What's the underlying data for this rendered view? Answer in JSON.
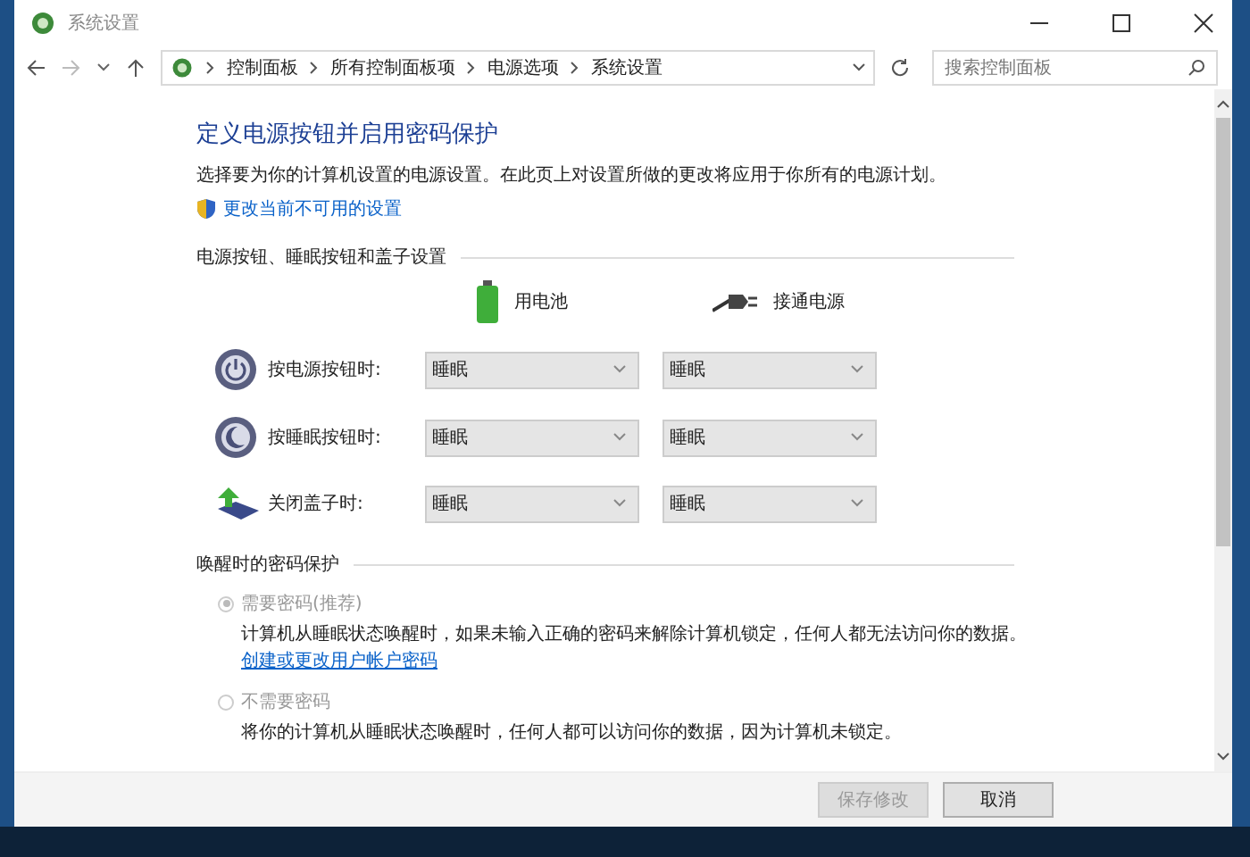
{
  "window": {
    "title": "系统设置"
  },
  "address_bar": {
    "breadcrumbs": [
      "控制面板",
      "所有控制面板项",
      "电源选项",
      "系统设置"
    ],
    "search": {
      "placeholder": "搜索控制面板"
    }
  },
  "page": {
    "heading": "定义电源按钮并启用密码保护",
    "description": "选择要为你的计算机设置的电源设置。在此页上对设置所做的更改将应用于你所有的电源计划。",
    "admin_link": "更改当前不可用的设置",
    "power_section": {
      "title": "电源按钮、睡眠按钮和盖子设置",
      "columns": [
        "用电池",
        "接通电源"
      ],
      "rows": [
        {
          "kind": "power",
          "label": "按电源按钮时:",
          "battery": "睡眠",
          "plugged": "睡眠"
        },
        {
          "kind": "sleep",
          "label": "按睡眠按钮时:",
          "battery": "睡眠",
          "plugged": "睡眠"
        },
        {
          "kind": "lid",
          "label": "关闭盖子时:",
          "battery": "睡眠",
          "plugged": "睡眠"
        }
      ]
    },
    "password_section": {
      "title": "唤醒时的密码保护",
      "options": [
        {
          "label": "需要密码(推荐)",
          "selected": true,
          "disabled": true,
          "description": "计算机从睡眠状态唤醒时，如果未输入正确的密码来解除计算机锁定，任何人都无法访问你的数据。",
          "link": "创建或更改用户帐户密码"
        },
        {
          "label": "不需要密码",
          "selected": false,
          "disabled": true,
          "description": "将你的计算机从睡眠状态唤醒时，任何人都可以访问你的数据，因为计算机未锁定。"
        }
      ]
    }
  },
  "footer": {
    "buttons": [
      {
        "label": "保存修改",
        "disabled": true
      },
      {
        "label": "取消",
        "disabled": false
      }
    ]
  }
}
